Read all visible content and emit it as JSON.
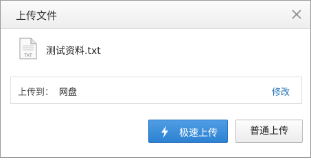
{
  "dialog": {
    "title": "上传文件",
    "close_icon": "close-icon"
  },
  "file": {
    "icon": "txt-file-icon",
    "icon_label": "TXT",
    "name": "测试资料.txt"
  },
  "destination": {
    "label": "上传到：",
    "value": "网盘",
    "edit_label": "修改"
  },
  "buttons": {
    "fast_upload_label": "极速上传",
    "fast_upload_icon": "lightning-icon",
    "normal_upload_label": "普通上传"
  },
  "colors": {
    "primary_button": "#2d82d2",
    "link": "#1f6fb5"
  }
}
